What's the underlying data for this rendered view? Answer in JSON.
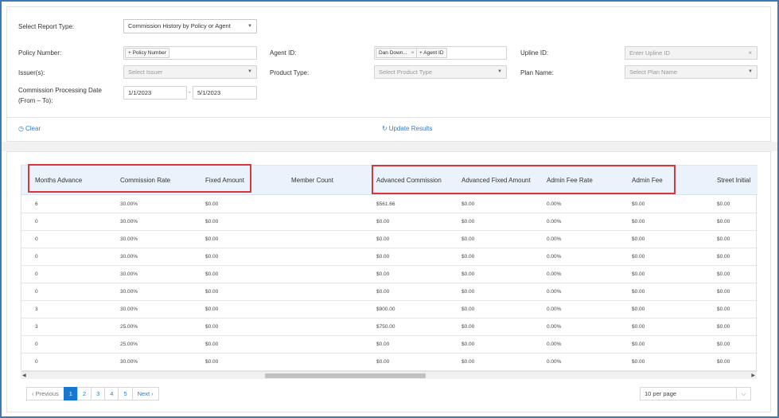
{
  "filters": {
    "report_type_label": "Select Report Type:",
    "report_type_value": "Commission History by Policy or Agent",
    "policy_number_label": "Policy Number:",
    "policy_number_chip": "+ Policy Number",
    "agent_id_label": "Agent ID:",
    "agent_chip": "Dan Down...",
    "agent_chip_remove": "×",
    "agent_add_chip": "+ Agent ID",
    "upline_id_label": "Upline ID:",
    "upline_id_placeholder": "Enter Upline ID",
    "issuers_label": "Issuer(s):",
    "issuers_placeholder": "Select Issuer",
    "product_type_label": "Product Type:",
    "product_type_placeholder": "Select Product Type",
    "plan_name_label": "Plan Name:",
    "plan_name_placeholder": "Select Plan Name",
    "processing_date_label_1": "Commission Processing Date",
    "processing_date_label_2": "(From – To):",
    "date_from": "1/1/2023",
    "date_sep": "-",
    "date_to": "5/1/2023"
  },
  "actions": {
    "clear": "Clear",
    "update": "Update Results"
  },
  "table": {
    "columns": [
      "Months Advance",
      "Commission Rate",
      "Fixed Amount",
      "Member Count",
      "Advanced Commission",
      "Advanced Fixed Amount",
      "Admin Fee Rate",
      "Admin Fee",
      "Street Initial"
    ],
    "rows": [
      [
        "6",
        "30.00%",
        "$0.00",
        "",
        "$561.66",
        "$0.00",
        "0.00%",
        "$0.00",
        "$0.00"
      ],
      [
        "0",
        "30.00%",
        "$0.00",
        "",
        "$0.00",
        "$0.00",
        "0.00%",
        "$0.00",
        "$0.00"
      ],
      [
        "0",
        "30.00%",
        "$0.00",
        "",
        "$0.00",
        "$0.00",
        "0.00%",
        "$0.00",
        "$0.00"
      ],
      [
        "0",
        "30.00%",
        "$0.00",
        "",
        "$0.00",
        "$0.00",
        "0.00%",
        "$0.00",
        "$0.00"
      ],
      [
        "0",
        "30.00%",
        "$0.00",
        "",
        "$0.00",
        "$0.00",
        "0.00%",
        "$0.00",
        "$0.00"
      ],
      [
        "0",
        "30.00%",
        "$0.00",
        "",
        "$0.00",
        "$0.00",
        "0.00%",
        "$0.00",
        "$0.00"
      ],
      [
        "3",
        "30.00%",
        "$0.00",
        "",
        "$900.00",
        "$0.00",
        "0.00%",
        "$0.00",
        "$0.00"
      ],
      [
        "3",
        "25.00%",
        "$0.00",
        "",
        "$750.00",
        "$0.00",
        "0.00%",
        "$0.00",
        "$0.00"
      ],
      [
        "0",
        "25.00%",
        "$0.00",
        "",
        "$0.00",
        "$0.00",
        "0.00%",
        "$0.00",
        "$0.00"
      ],
      [
        "0",
        "30.00%",
        "$0.00",
        "",
        "$0.00",
        "$0.00",
        "0.00%",
        "$0.00",
        "$0.00"
      ]
    ]
  },
  "pagination": {
    "previous": "Previous",
    "pages": [
      "1",
      "2",
      "3",
      "4",
      "5"
    ],
    "active_page": "1",
    "next": "Next",
    "per_page": "10 per page"
  },
  "colors": {
    "frame_border": "#3f79b6",
    "accent": "#1778d4",
    "link": "#2f7bd8",
    "highlight_box": "#d9353a",
    "header_bg": "#eaf3fb"
  },
  "icons": {
    "dropdown": "chevron-down-icon",
    "clear": "clock-icon",
    "update": "refresh-icon",
    "previous": "chevron-left-icon",
    "next": "chevron-right-icon"
  }
}
